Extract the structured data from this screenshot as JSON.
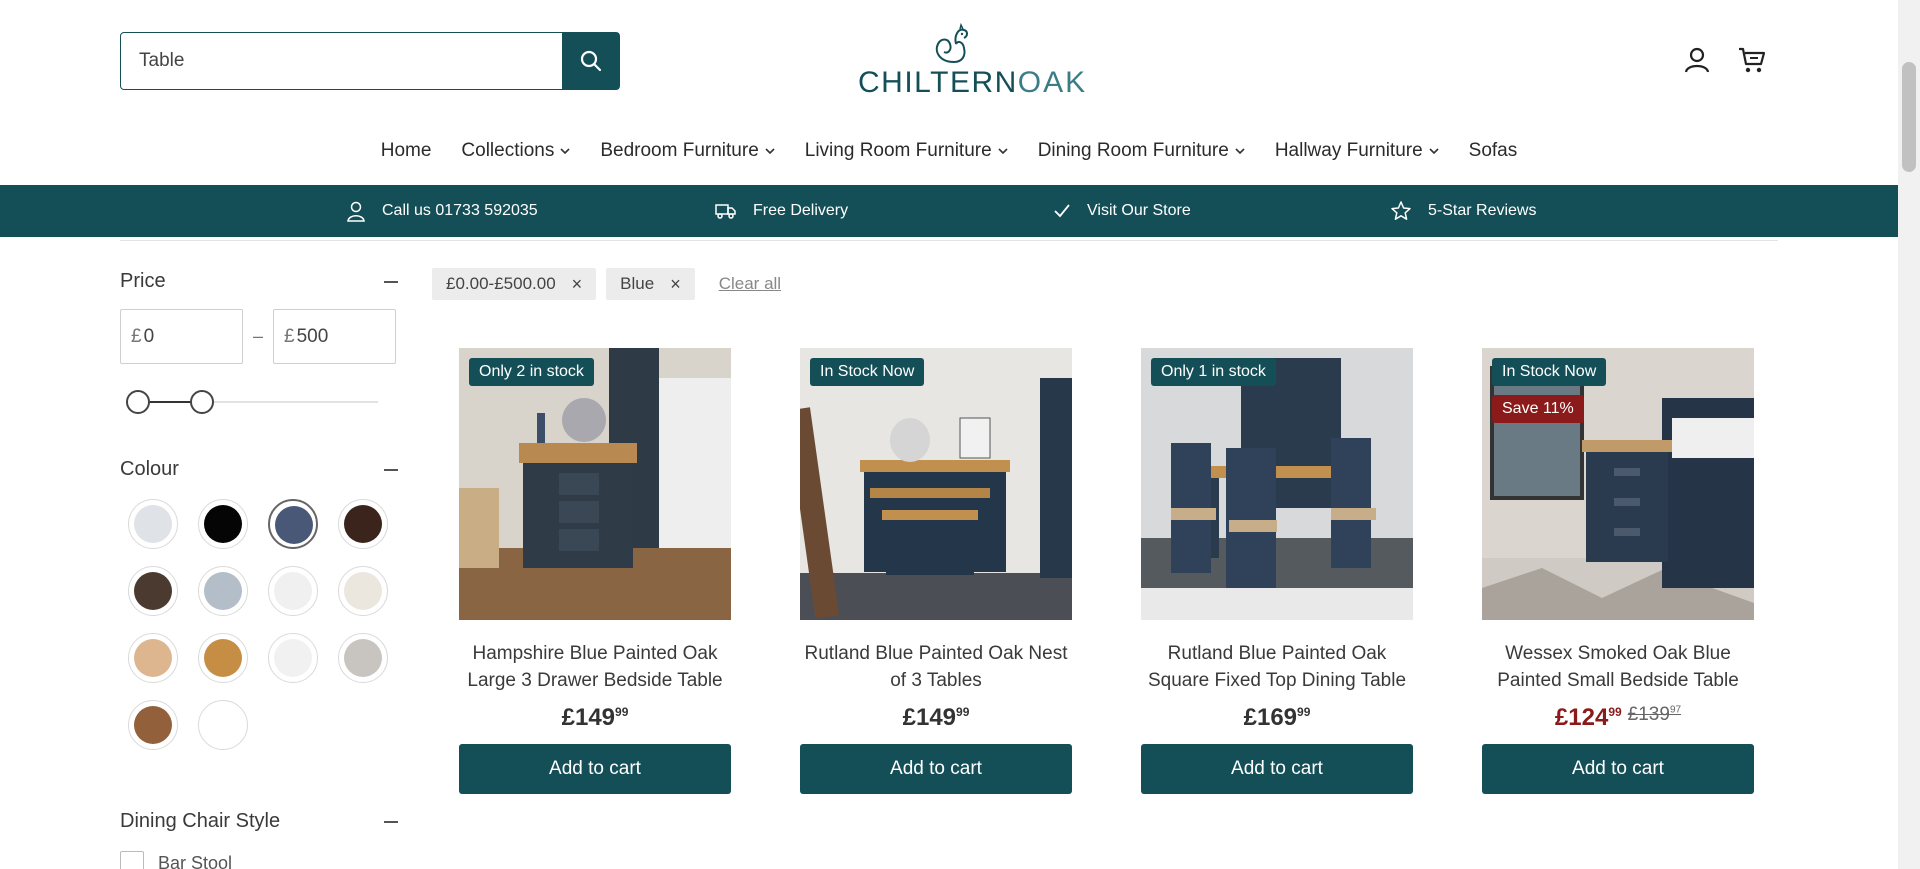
{
  "header": {
    "search_value": "Table",
    "logo_text_bold": "CHILTERN",
    "logo_text_light": "OAK"
  },
  "nav": [
    "Home",
    "Collections",
    "Bedroom Furniture",
    "Living Room Furniture",
    "Dining Room Furniture",
    "Hallway Furniture",
    "Sofas"
  ],
  "usp": [
    {
      "icon": "user-icon",
      "label": "Call us 01733 592035"
    },
    {
      "icon": "truck-icon",
      "label": "Free Delivery"
    },
    {
      "icon": "check-icon",
      "label": "Visit Our Store"
    },
    {
      "icon": "star-icon",
      "label": "5-Star Reviews"
    }
  ],
  "filters": {
    "price": {
      "title": "Price",
      "currency": "£",
      "min": "0",
      "max": "500",
      "separator": "–",
      "range_low_fraction": 0.0,
      "range_high_fraction": 0.28
    },
    "colour": {
      "title": "Colour",
      "swatches": [
        {
          "name": "light-grey",
          "color": "#dfe2e6",
          "selected": false
        },
        {
          "name": "black",
          "color": "#050505",
          "selected": false
        },
        {
          "name": "blue",
          "color": "#4a5878",
          "selected": true
        },
        {
          "name": "dark-brown",
          "color": "#3a241c",
          "selected": false
        },
        {
          "name": "smoked-oak",
          "color": "#4a3a30",
          "selected": false
        },
        {
          "name": "pale-blue",
          "color": "#b4bec8",
          "selected": false
        },
        {
          "name": "white",
          "color": "#f0f0f0",
          "selected": false
        },
        {
          "name": "cream",
          "color": "#ebe7de",
          "selected": false
        },
        {
          "name": "light-oak",
          "color": "#ddb68f",
          "selected": false
        },
        {
          "name": "oak",
          "color": "#c68e45",
          "selected": false
        },
        {
          "name": "off-white",
          "color": "#f1f1f1",
          "selected": false
        },
        {
          "name": "stone",
          "color": "#c8c5c1",
          "selected": false
        },
        {
          "name": "walnut",
          "color": "#93603c",
          "selected": false
        },
        {
          "name": "clear",
          "color": "#ffffff",
          "selected": false
        }
      ]
    },
    "dining_chair_style": {
      "title": "Dining Chair Style",
      "options": [
        "Bar Stool"
      ]
    }
  },
  "active_filters": {
    "chips": [
      "£0.00-£500.00",
      "Blue"
    ],
    "clear_label": "Clear all"
  },
  "products": [
    {
      "name": "Hampshire Blue Painted Oak Large 3 Drawer Bedside Table",
      "badges": [
        {
          "text": "Only 2 in stock",
          "style": "teal"
        }
      ],
      "price_main": "£149",
      "price_pence": "99",
      "was_main": "",
      "was_pence": "",
      "cta": "Add to cart"
    },
    {
      "name": "Rutland Blue Painted Oak Nest of 3 Tables",
      "badges": [
        {
          "text": "In Stock Now",
          "style": "teal"
        }
      ],
      "price_main": "£149",
      "price_pence": "99",
      "was_main": "",
      "was_pence": "",
      "cta": "Add to cart"
    },
    {
      "name": "Rutland Blue Painted Oak Square Fixed Top Dining Table",
      "badges": [
        {
          "text": "Only 1 in stock",
          "style": "teal"
        }
      ],
      "price_main": "£169",
      "price_pence": "99",
      "was_main": "",
      "was_pence": "",
      "cta": "Add to cart"
    },
    {
      "name": "Wessex Smoked Oak Blue Painted Small Bedside Table",
      "badges": [
        {
          "text": "In Stock Now",
          "style": "teal"
        },
        {
          "text": "Save 11%",
          "style": "red"
        }
      ],
      "price_main": "£124",
      "price_pence": "99",
      "was_main": "£139",
      "was_pence": "97",
      "cta": "Add to cart"
    }
  ],
  "colors": {
    "brand_teal": "#144f58",
    "sale_red": "#8b1a1a"
  }
}
